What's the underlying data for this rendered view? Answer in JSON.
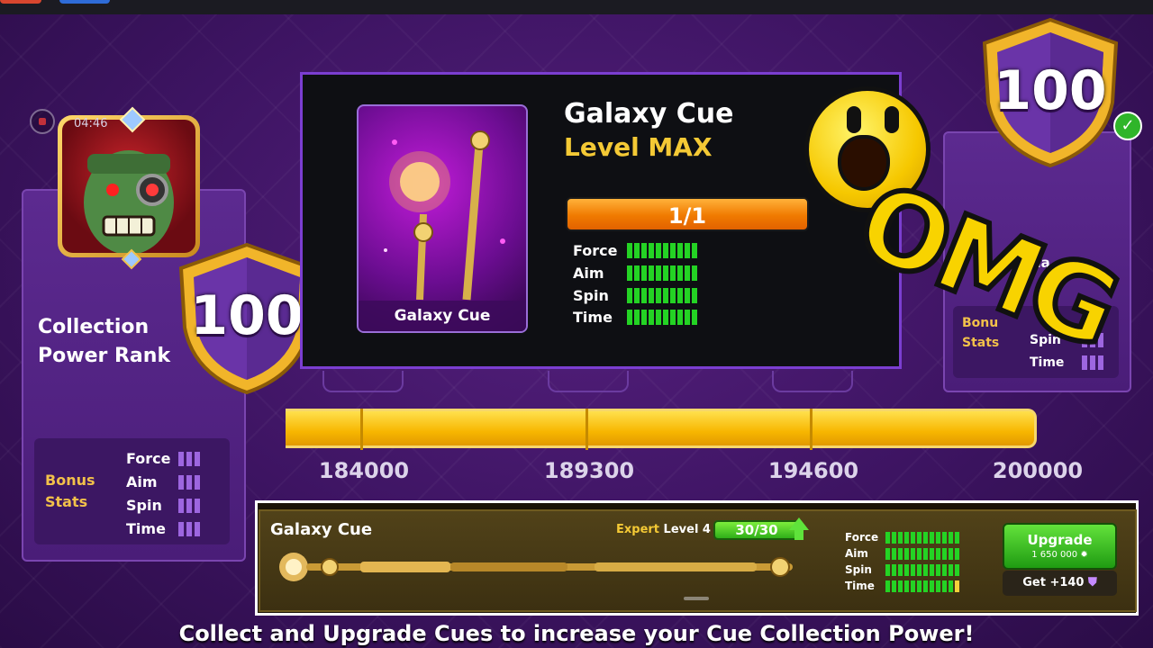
{
  "top_bar": {},
  "recording": {
    "timer": "04:46"
  },
  "left_panel": {
    "title_line1": "Collection",
    "title_line2": "Power Rank",
    "rank": "100",
    "bonus_label_1": "Bonus",
    "bonus_label_2": "Stats",
    "stats": [
      "Force",
      "Aim",
      "Spin",
      "Time"
    ]
  },
  "cue_popup": {
    "card_label": "Galaxy Cue",
    "name": "Galaxy Cue",
    "level": "Level MAX",
    "progress": "1/1",
    "stats": [
      {
        "name": "Force",
        "value": 10,
        "max": 10
      },
      {
        "name": "Aim",
        "value": 10,
        "max": 10
      },
      {
        "name": "Spin",
        "value": 10,
        "max": 10
      },
      {
        "name": "Time",
        "value": 10,
        "max": 10
      }
    ]
  },
  "right_card": {
    "rank": "100",
    "partial_title": "Dia",
    "bonus_label_1": "Bonu",
    "bonus_label_2": "Stats",
    "stats": [
      "Spin",
      "Time"
    ]
  },
  "sticker": {
    "text": "OMG"
  },
  "track": {
    "milestones": [
      "184000",
      "189300",
      "194600",
      "200000"
    ]
  },
  "cue_row": {
    "name": "Galaxy Cue",
    "expert_label": "Expert",
    "level_label": "Level 4",
    "level_progress": "30/30",
    "stats": [
      {
        "name": "Force",
        "value": 12,
        "max": 12
      },
      {
        "name": "Aim",
        "value": 12,
        "max": 12
      },
      {
        "name": "Spin",
        "value": 12,
        "max": 12
      },
      {
        "name": "Time",
        "value": 11,
        "max": 12
      }
    ],
    "upgrade_label": "Upgrade",
    "upgrade_cost": "1 650 000",
    "get_label": "Get +140"
  },
  "caption": "Collect and Upgrade Cues to increase your Cue Collection Power!",
  "colors": {
    "accent_gold": "#f4c935",
    "stat_green": "#24d324",
    "panel_purple": "#4a1d78",
    "popup_border": "#7b3ed1"
  }
}
